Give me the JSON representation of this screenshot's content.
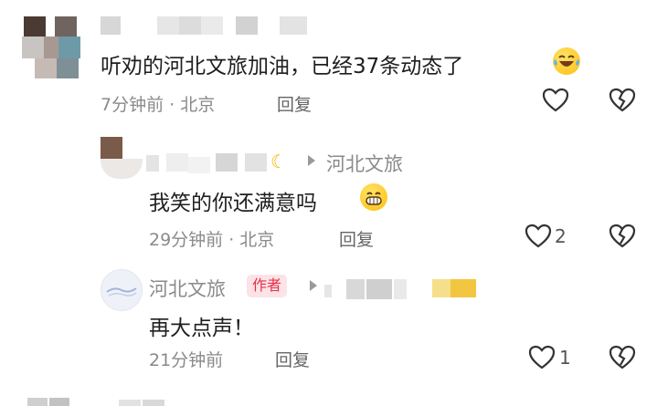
{
  "comments": [
    {
      "text": "听劝的河北文旅加油，已经37条动态了",
      "emoji": "laughing-tears-emoji",
      "time": "7分钟前 · 北京",
      "reply_label": "回复"
    }
  ],
  "replies": [
    {
      "target": "河北文旅",
      "text": "我笑的你还满意吗",
      "emoji": "grinning-emoji",
      "time": "29分钟前 · 北京",
      "reply_label": "回复",
      "likes": "2"
    },
    {
      "author": "河北文旅",
      "author_tag": "作者",
      "text": "再大点声！",
      "time": "21分钟前",
      "reply_label": "回复",
      "likes": "1"
    }
  ],
  "colors": {
    "author_tag_bg": "#fbe3e7",
    "author_tag_text": "#e8304a",
    "meta_text": "#8a8a8a"
  }
}
